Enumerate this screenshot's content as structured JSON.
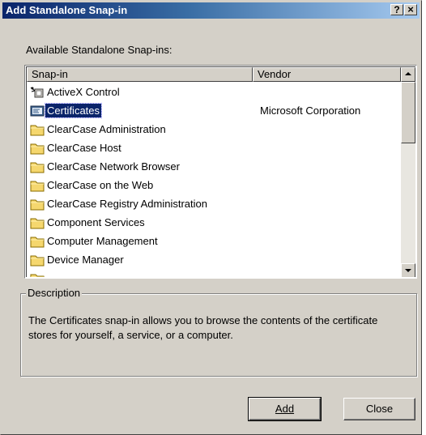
{
  "window": {
    "title": "Add Standalone Snap-in"
  },
  "caption_buttons": {
    "help": "?",
    "close": "×"
  },
  "available_label": "Available Standalone Snap-ins:",
  "columns": {
    "snapin": "Snap-in",
    "vendor": "Vendor"
  },
  "rows": [
    {
      "name": "ActiveX Control",
      "vendor": "",
      "icon": "activex-control-icon"
    },
    {
      "name": "Certificates",
      "vendor": "Microsoft Corporation",
      "icon": "certificates-icon",
      "selected": true
    },
    {
      "name": "ClearCase Administration",
      "vendor": "",
      "icon": "folder-icon"
    },
    {
      "name": "ClearCase Host",
      "vendor": "",
      "icon": "folder-icon"
    },
    {
      "name": "ClearCase Network Browser",
      "vendor": "",
      "icon": "folder-icon"
    },
    {
      "name": "ClearCase on the Web",
      "vendor": "",
      "icon": "folder-icon"
    },
    {
      "name": "ClearCase Registry Administration",
      "vendor": "",
      "icon": "folder-icon"
    },
    {
      "name": "Component Services",
      "vendor": "",
      "icon": "folder-icon"
    },
    {
      "name": "Computer Management",
      "vendor": "",
      "icon": "folder-icon"
    },
    {
      "name": "Device Manager",
      "vendor": "",
      "icon": "folder-icon"
    },
    {
      "name": "",
      "vendor": "",
      "icon": "folder-icon"
    }
  ],
  "description": {
    "legend": "Description",
    "text": "The Certificates snap-in allows you to browse the contents of the certificate stores for yourself, a service, or a computer."
  },
  "buttons": {
    "add": "Add",
    "close": "Close"
  },
  "colors": {
    "title_start": "#0a246a",
    "title_end": "#a6caf0",
    "face": "#d4d0c8",
    "selection": "#0a246a",
    "folder": "#f5d76e"
  }
}
